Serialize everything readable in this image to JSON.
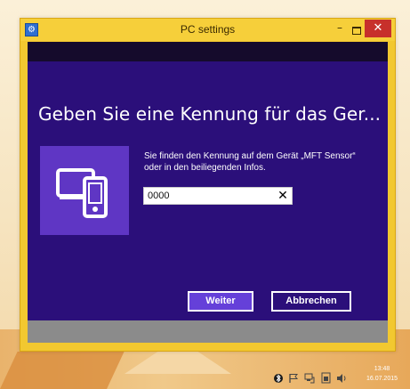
{
  "window": {
    "title": "PC settings",
    "minimize_glyph": "–",
    "close_glyph": "✕"
  },
  "dialog": {
    "heading": "Geben Sie eine Kennung für das Ger...",
    "description": "Sie finden den Kennung auf dem Gerät „MFT Sensor“ oder in den beiliegenden Infos.",
    "pin_value": "0000",
    "clear_glyph": "✕",
    "next_label": "Weiter",
    "cancel_label": "Abbrechen"
  },
  "colors": {
    "window_frame": "#f2c830",
    "dialog_background": "#2b0f7a",
    "device_tile": "#5f36c4",
    "close_button": "#c7302b"
  },
  "taskbar": {
    "tray_icons": [
      "bluetooth-icon",
      "flag-icon",
      "network-icon",
      "battery-icon",
      "volume-icon"
    ],
    "time": "13:48",
    "date": "16.07.2015"
  }
}
